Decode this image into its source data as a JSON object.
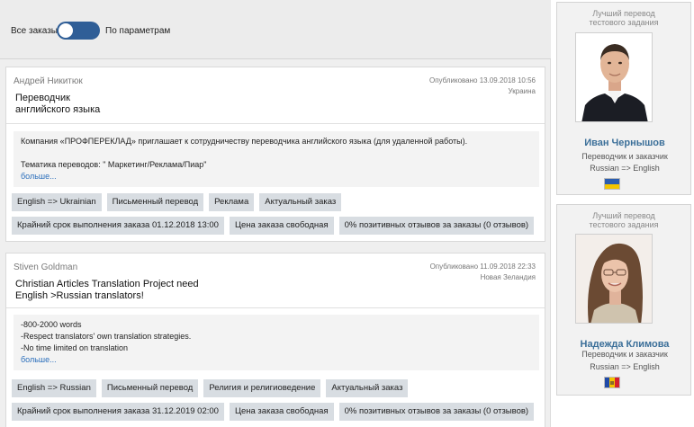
{
  "filter": {
    "left_label": "Все заказы",
    "right_label": "По параметрам"
  },
  "orders": [
    {
      "author": "Андрей Никитюк",
      "published": "Опубликовано 13.09.2018 10:56",
      "location": "Украина",
      "title_line1": "Переводчик",
      "title_line2": "английского языка",
      "body_line1": "Компания «ПРОФПЕРЕКЛАД» приглашает к сотрудничеству переводчика английского языка (для удаленной работы).",
      "body_line2": "Тематика переводов: \" Маркетинг/Реклама/Пиар\"",
      "more": "больше...",
      "tags_row1": [
        "English => Ukrainian",
        "Письменный перевод",
        "Реклама",
        "Актуальный заказ"
      ],
      "tags_row2": [
        "Крайний срок выполнения заказа 01.12.2018 13:00",
        "Цена заказа свободная",
        "0% позитивных отзывов за заказы (0 отзывов)"
      ]
    },
    {
      "author": "Stiven Goldman",
      "published": "Опубликовано 11.09.2018 22:33",
      "location": "Новая Зеландия",
      "title_line1": "Christian Articles Translation Project need",
      "title_line2": "English >Russian translators!",
      "body_line1": "-800-2000 words",
      "body_line2": "-Respect translators' own translation strategies.",
      "body_line3": "-No time limited on translation",
      "more": "больше...",
      "tags_row1": [
        "English => Russian",
        "Письменный перевод",
        "Религия и религиоведение",
        "Актуальный заказ"
      ],
      "tags_row2": [
        "Крайний срок выполнения заказа 31.12.2019 02:00",
        "Цена заказа свободная",
        "0% позитивных отзывов за заказы (0 отзывов)"
      ]
    }
  ],
  "sidebar": [
    {
      "heading_line1": "Лучший перевод",
      "heading_line2": "тестового задания",
      "name": "Иван Чернышов",
      "role": "Переводчик и заказчик",
      "pair": "Russian => English",
      "flag_colors": [
        "#2a5db0",
        "#f2c500"
      ]
    },
    {
      "heading_line1": "Лучший перевод",
      "heading_line2": "тестового задания",
      "name": "Надежда Климова",
      "role": "Переводчик и заказчик",
      "pair": "Russian => English",
      "flag_colors": [
        "#1f4aa8",
        "#f4c300",
        "#d4202e"
      ]
    }
  ]
}
